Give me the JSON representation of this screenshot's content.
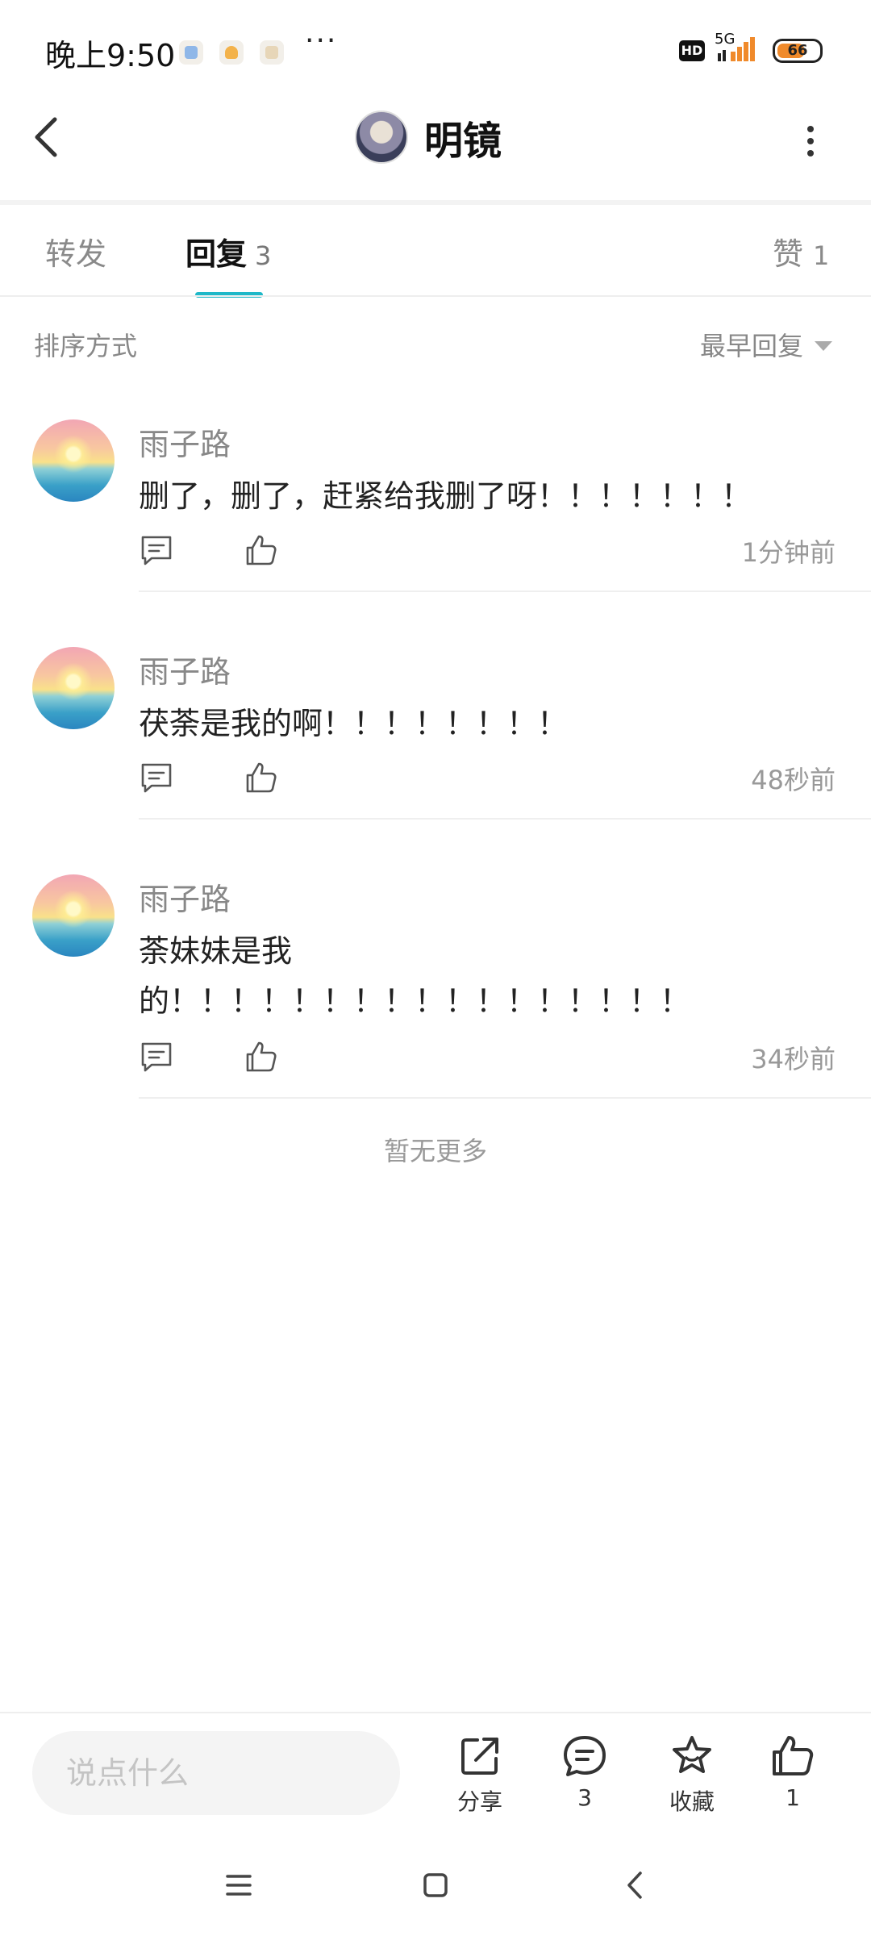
{
  "status_bar": {
    "time": "晚上9:50",
    "more": "···",
    "hd": "HD",
    "network": "5G",
    "battery": "66",
    "battery_level": 0.66
  },
  "header": {
    "title": "明镜",
    "back_icon": "chevron-left-icon",
    "more_icon": "more-vertical-icon"
  },
  "tabs": {
    "forward": {
      "label": "转发"
    },
    "reply": {
      "label": "回复",
      "count": "3"
    },
    "like": {
      "label": "赞",
      "count": "1"
    },
    "active_color": "#1fb8c8"
  },
  "sort": {
    "label": "排序方式",
    "value": "最早回复"
  },
  "comments": [
    {
      "name": "雨子路",
      "text": "删了，删了，赶紧给我删了呀！！！！！！！",
      "time": "1分钟前"
    },
    {
      "name": "雨子路",
      "text": "茯荼是我的啊！！！！！！！！",
      "time": "48秒前"
    },
    {
      "name": "雨子路",
      "text": "荼妹妹是我的！！！！！！！！！！！！！！！！！",
      "time": "34秒前"
    }
  ],
  "footer_note": "暂无更多",
  "bottom_bar": {
    "input_placeholder": "说点什么",
    "share_label": "分享",
    "comment_count": "3",
    "favorite_label": "收藏",
    "like_count": "1"
  }
}
